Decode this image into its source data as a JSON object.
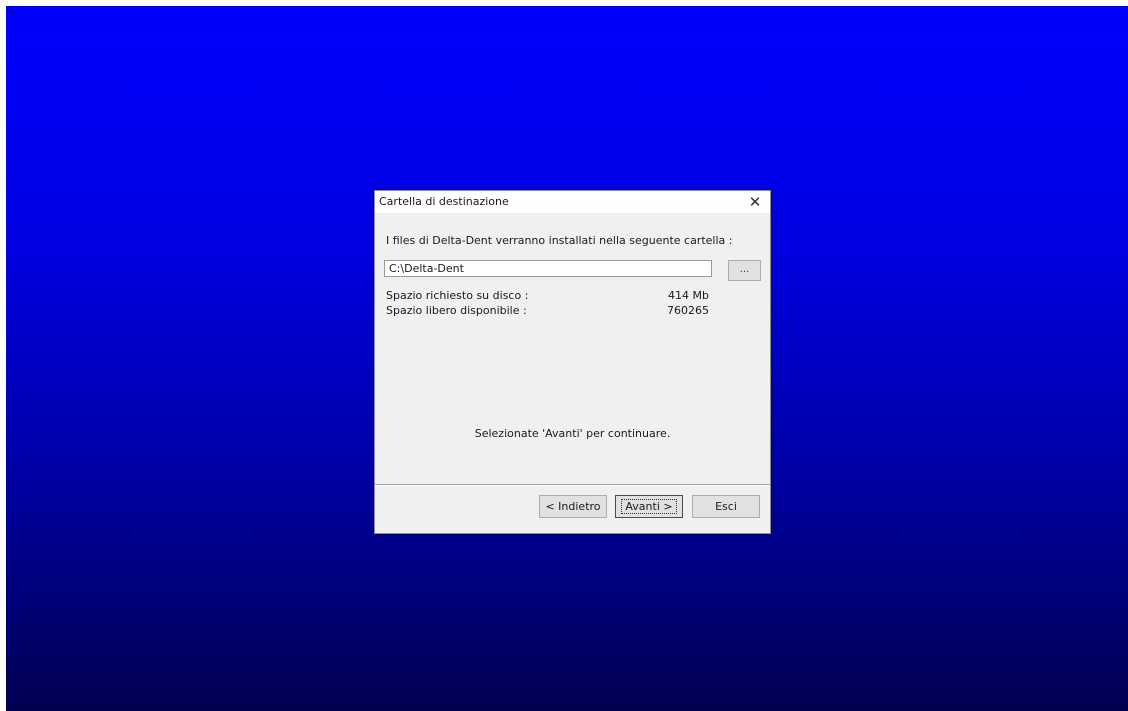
{
  "dialog": {
    "title": "Cartella di destinazione",
    "close_glyph": "✕",
    "intro_text": "I files di Delta-Dent verranno installati nella seguente cartella :",
    "path_value": "C:\\Delta-Dent",
    "browse_label": "...",
    "required_space_label": "Spazio richiesto su disco :",
    "required_space_value": "414 Mb",
    "free_space_label": "Spazio libero disponibile :",
    "free_space_value": "760265",
    "continue_message": "Selezionate 'Avanti' per continuare.",
    "back_label": "< Indietro",
    "next_label": "Avanti >",
    "exit_label": "Esci"
  },
  "colors": {
    "desktop_top": "#0000ff",
    "desktop_bottom": "#000050",
    "dialog_bg": "#f0f0f0"
  },
  "icons": {
    "close": "close-icon"
  }
}
